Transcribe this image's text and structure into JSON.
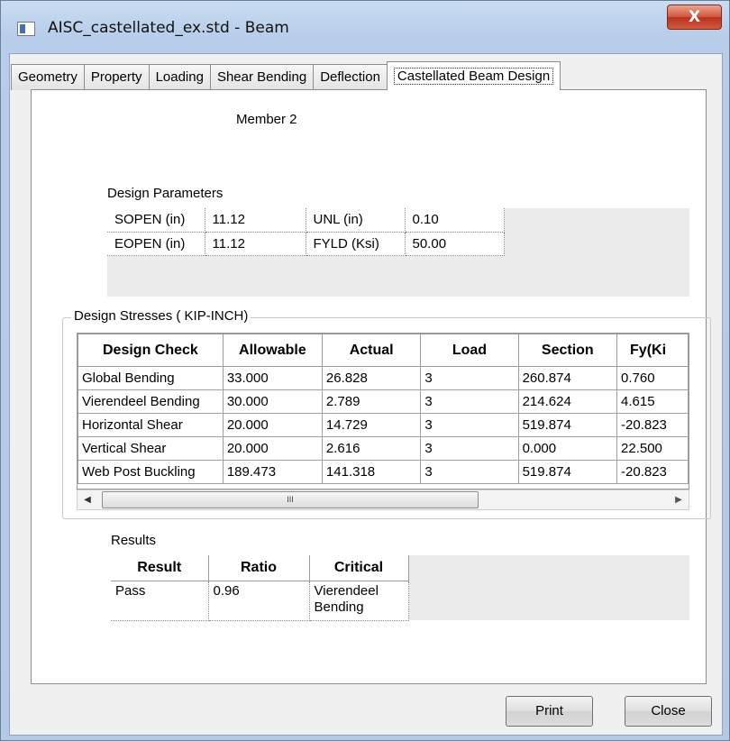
{
  "window": {
    "title": "AISC_castellated_ex.std - Beam",
    "close_label": "X"
  },
  "tabs": [
    {
      "label": "Geometry"
    },
    {
      "label": "Property"
    },
    {
      "label": "Loading"
    },
    {
      "label": "Shear Bending"
    },
    {
      "label": "Deflection"
    },
    {
      "label": "Castellated Beam Design"
    }
  ],
  "member_label": "Member 2",
  "design_parameters": {
    "label": "Design Parameters",
    "rows": [
      [
        "SOPEN (in)",
        "11.12",
        "UNL (in)",
        "0.10"
      ],
      [
        "EOPEN (in)",
        "11.12",
        "FYLD (Ksi)",
        "50.00"
      ]
    ]
  },
  "design_stresses": {
    "label": "Design Stresses ( KIP-INCH)",
    "headers": [
      "Design Check",
      "Allowable",
      "Actual",
      "Load",
      "Section",
      "Fy(Ki"
    ],
    "rows": [
      [
        "Global Bending",
        "33.000",
        "26.828",
        "3",
        "260.874",
        "0.760"
      ],
      [
        "Vierendeel Bending",
        "30.000",
        "2.789",
        "3",
        "214.624",
        "4.615"
      ],
      [
        "Horizontal Shear",
        "20.000",
        "14.729",
        "3",
        "519.874",
        "-20.823"
      ],
      [
        "Vertical Shear",
        "20.000",
        "2.616",
        "3",
        "0.000",
        "22.500"
      ],
      [
        "Web Post Buckling",
        "189.473",
        "141.318",
        "3",
        "519.874",
        "-20.823"
      ]
    ]
  },
  "scrollbar": {
    "left_arrow": "◀",
    "right_arrow": "▶",
    "grip": "III"
  },
  "results": {
    "label": "Results",
    "headers": [
      "Result",
      "Ratio",
      "Critical"
    ],
    "row": [
      "Pass",
      "0.96",
      "Vierendeel Bending"
    ]
  },
  "buttons": {
    "print": "Print",
    "close": "Close"
  }
}
